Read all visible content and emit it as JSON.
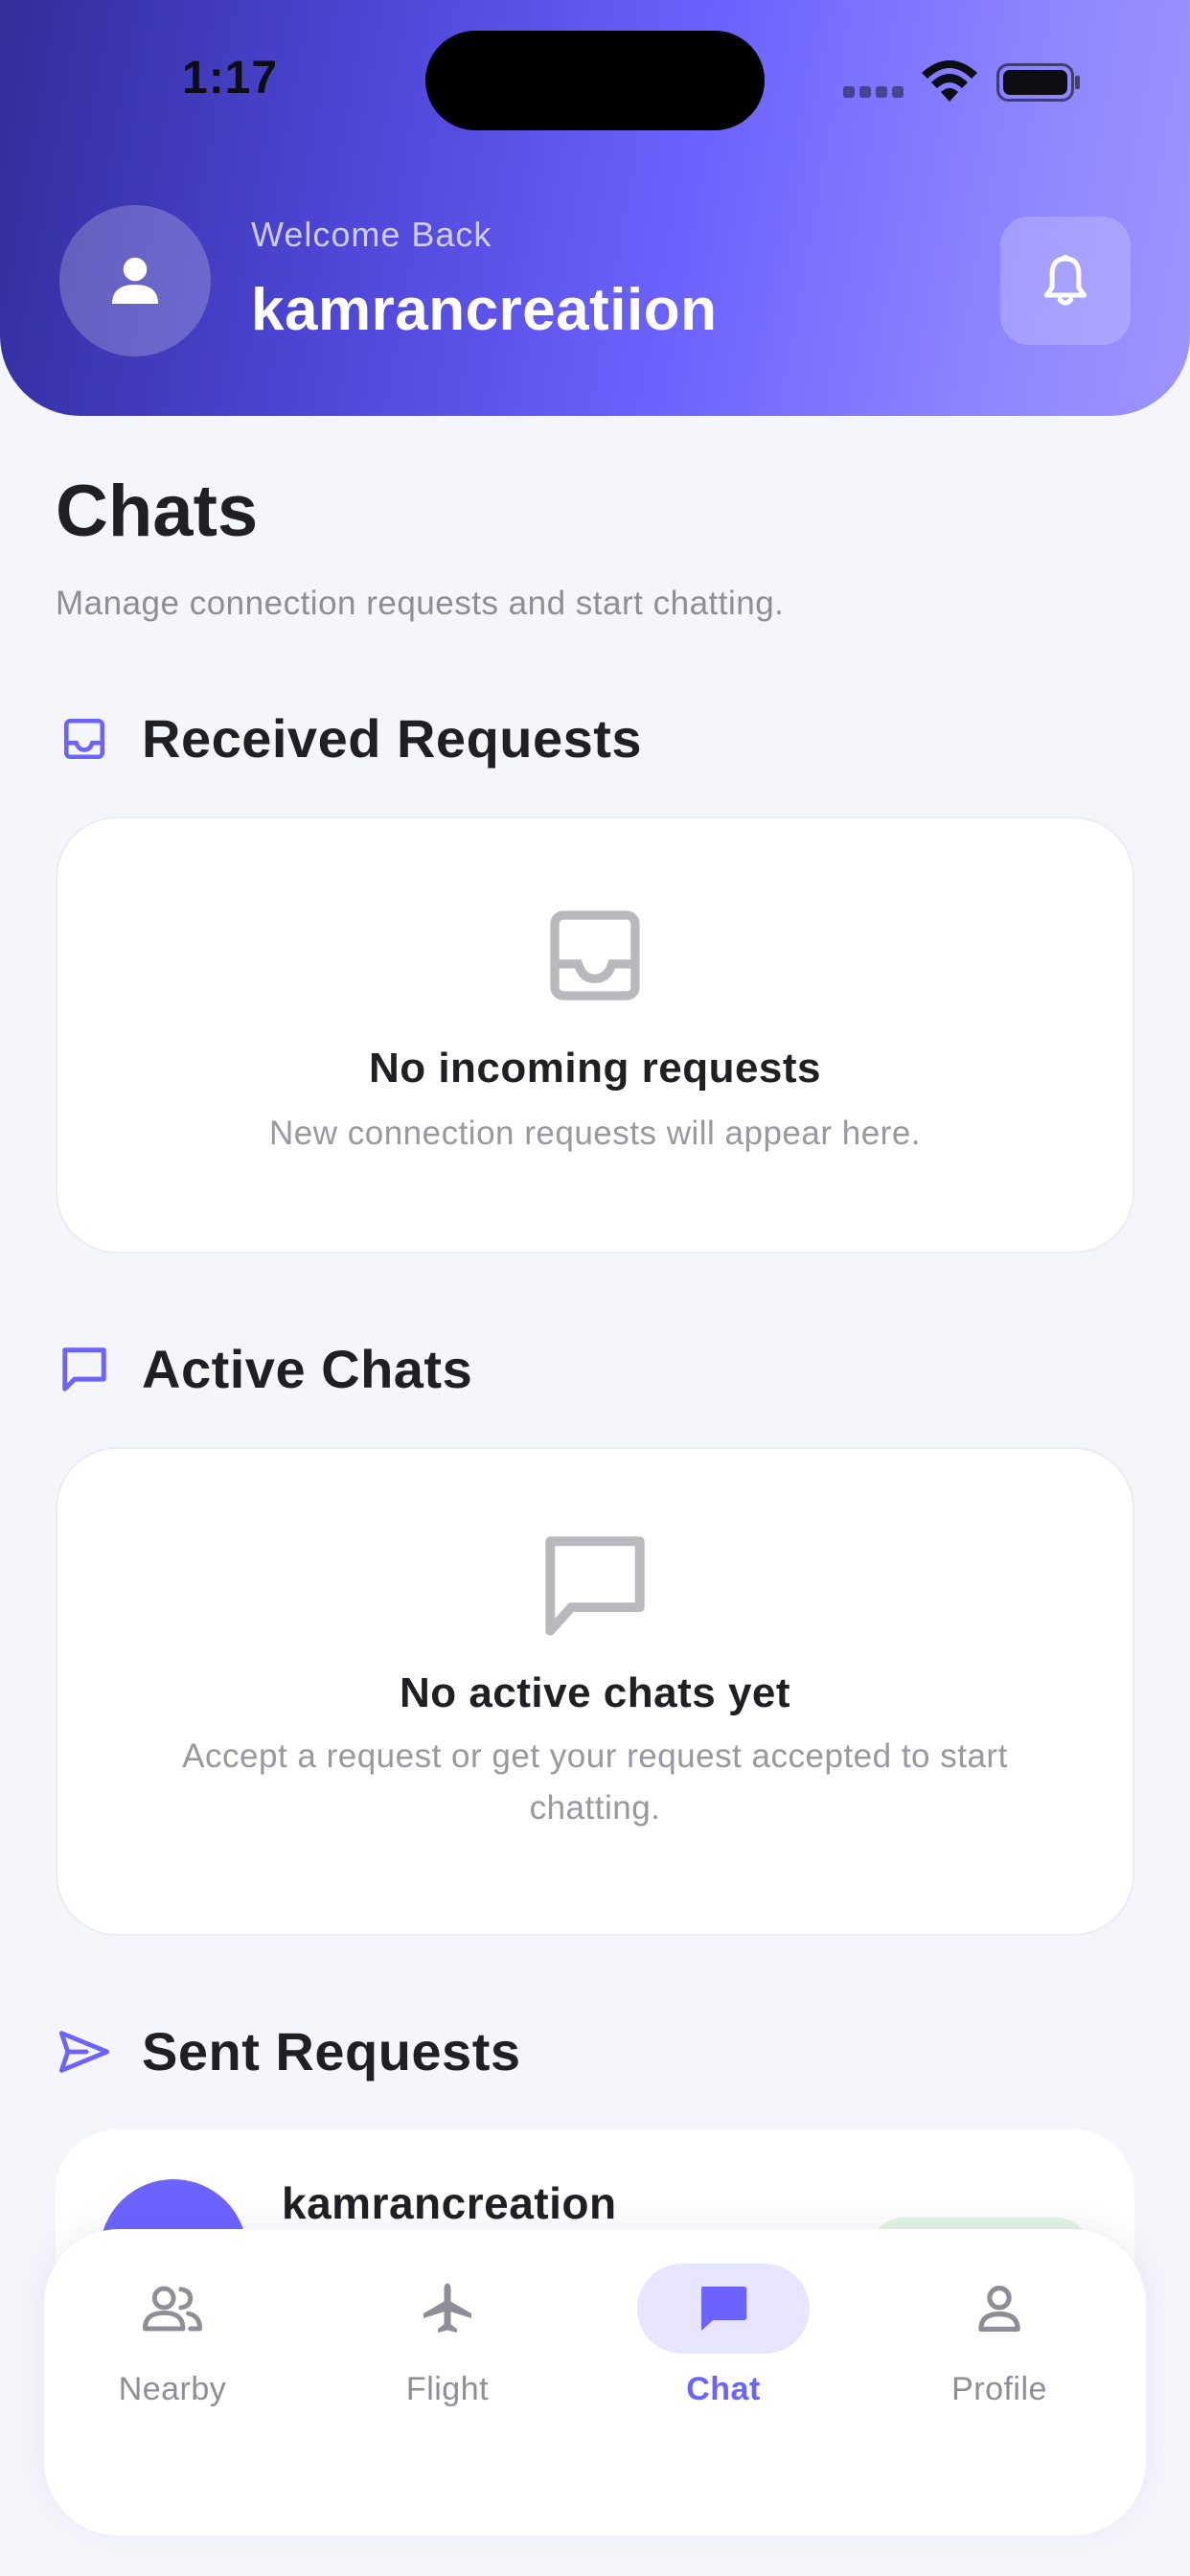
{
  "status_bar": {
    "time": "1:17"
  },
  "header": {
    "welcome": "Welcome Back",
    "username": "kamrancreatiion",
    "avatar_icon": "person-icon",
    "notification_icon": "bell-icon"
  },
  "page": {
    "title": "Chats",
    "subtitle": "Manage connection requests and start chatting."
  },
  "sections": {
    "received": {
      "title": "Received Requests",
      "icon": "inbox-icon",
      "empty_title": "No incoming requests",
      "empty_desc": "New connection requests will appear here."
    },
    "active": {
      "title": "Active Chats",
      "icon": "chat-bubble-icon",
      "empty_title": "No active chats yet",
      "empty_desc": "Accept a request or get your request accepted to start chatting."
    },
    "sent": {
      "title": "Sent Requests",
      "icon": "send-icon",
      "items": [
        {
          "name": "kamrancreation"
        }
      ]
    }
  },
  "bottom_nav": {
    "items": [
      {
        "label": "Nearby",
        "icon": "people-icon"
      },
      {
        "label": "Flight",
        "icon": "airplane-icon"
      },
      {
        "label": "Chat",
        "icon": "chat-icon",
        "active": true
      },
      {
        "label": "Profile",
        "icon": "person-outline-icon"
      }
    ]
  },
  "colors": {
    "accent": "#6c63ff",
    "header_start": "#312d9a",
    "header_end": "#9d95ff",
    "background": "#f5f5fc",
    "muted_text": "#8e8e96",
    "empty_icon": "#b8b8bd"
  }
}
